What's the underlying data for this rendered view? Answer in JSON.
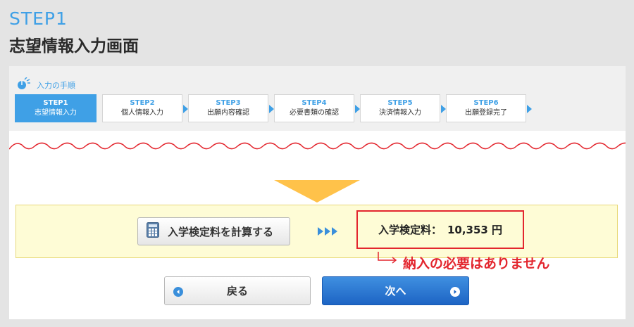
{
  "header": {
    "step": "STEP1",
    "title": "志望情報入力画面"
  },
  "procedure": {
    "heading": "入力の手順",
    "steps": [
      {
        "num": "STEP1",
        "label": "志望情報入力",
        "active": true
      },
      {
        "num": "STEP2",
        "label": "個人情報入力",
        "active": false
      },
      {
        "num": "STEP3",
        "label": "出願内容確認",
        "active": false
      },
      {
        "num": "STEP4",
        "label": "必要書類の確認",
        "active": false
      },
      {
        "num": "STEP5",
        "label": "決済情報入力",
        "active": false
      },
      {
        "num": "STEP6",
        "label": "出願登録完了",
        "active": false
      }
    ]
  },
  "fee": {
    "calc_button": "入学検定料を計算する",
    "result_label": "入学検定料：",
    "result_value": "10,353 円"
  },
  "note": "納入の必要はありません",
  "nav": {
    "back": "戻る",
    "next": "次へ"
  },
  "colors": {
    "accent": "#3fa0e6",
    "alert": "#e3262e",
    "arrow": "#ffc24a",
    "next_button": "#1d64c4"
  },
  "icons": {
    "procedure": "mouse-cursor-icon",
    "calc": "calculator-icon",
    "back": "chevron-left-circle-icon",
    "next": "chevron-right-circle-icon"
  }
}
